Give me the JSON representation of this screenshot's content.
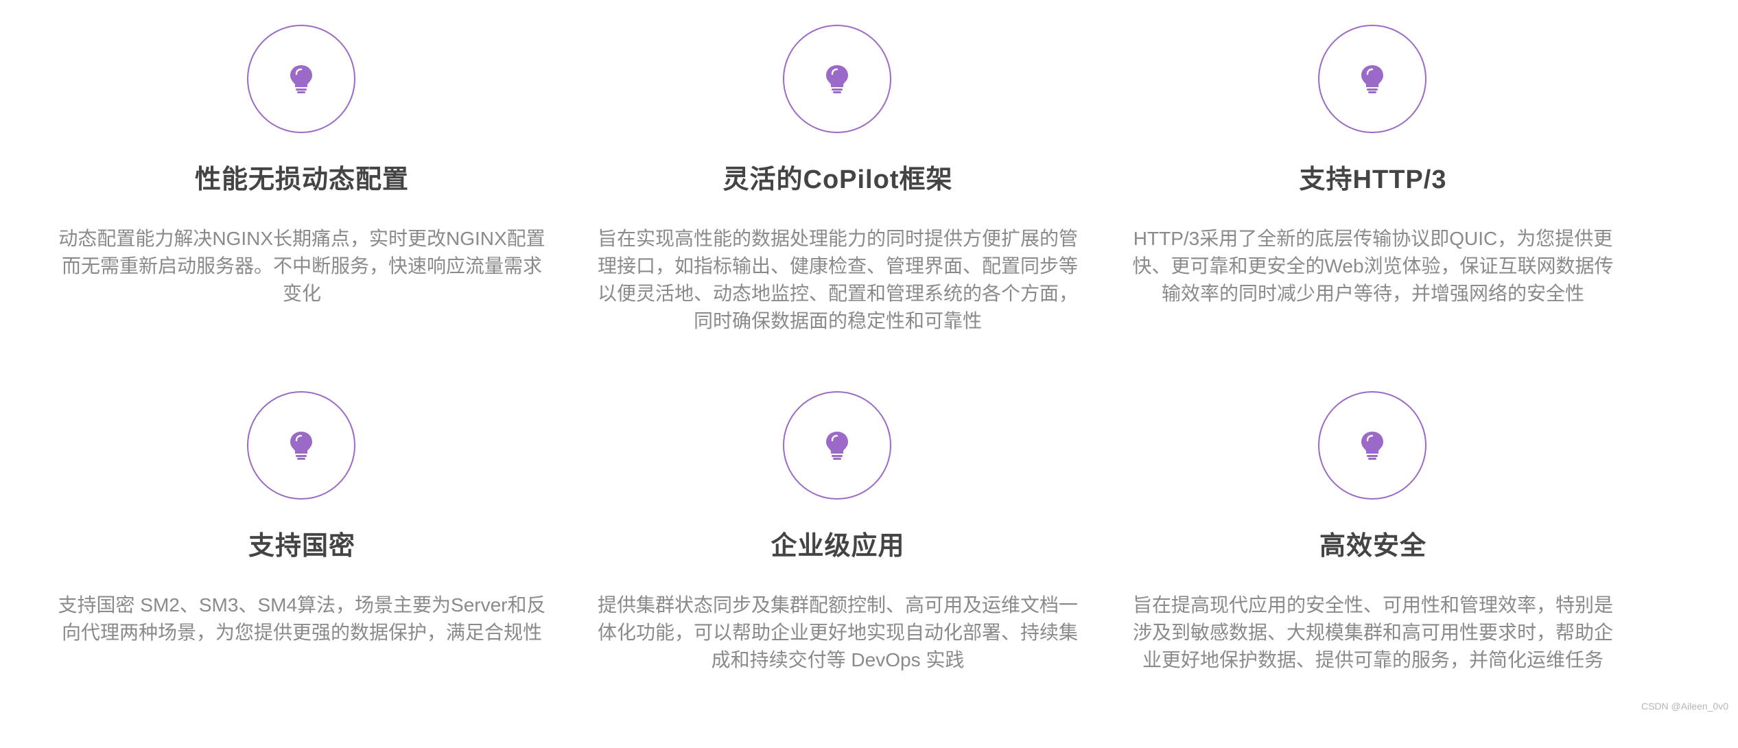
{
  "brand": {
    "accent": "#9b6ac8",
    "title_color": "#444444",
    "text_color": "#8a8a8a"
  },
  "features": [
    {
      "icon": "lightbulb-icon",
      "title": "性能无损动态配置",
      "lines": [
        "动态配置能力解决NGINX长期痛点，实时更改NGINX配置",
        "而无需重新启动服务器。不中断服务，快速响应流量需求",
        "变化"
      ]
    },
    {
      "icon": "lightbulb-icon",
      "title": "灵活的CoPilot框架",
      "lines": [
        "旨在实现高性能的数据处理能力的同时提供方便扩展的管",
        "理接口，如指标输出、健康检查、管理界面、配置同步等",
        "以便灵活地、动态地监控、配置和管理系统的各个方面，",
        "同时确保数据面的稳定性和可靠性"
      ]
    },
    {
      "icon": "lightbulb-icon",
      "title": "支持HTTP/3",
      "lines": [
        "HTTP/3采用了全新的底层传输协议即QUIC，为您提供更",
        "快、更可靠和更安全的Web浏览体验，保证互联网数据传",
        "输效率的同时减少用户等待，并增强网络的安全性"
      ]
    },
    {
      "icon": "lightbulb-icon",
      "title": "支持国密",
      "lines": [
        "支持国密 SM2、SM3、SM4算法，场景主要为Server和反",
        "向代理两种场景，为您提供更强的数据保护，满足合规性"
      ]
    },
    {
      "icon": "lightbulb-icon",
      "title": "企业级应用",
      "lines": [
        "提供集群状态同步及集群配额控制、高可用及运维文档一",
        "体化功能，可以帮助企业更好地实现自动化部署、持续集",
        "成和持续交付等 DevOps 实践"
      ]
    },
    {
      "icon": "lightbulb-icon",
      "title": "高效安全",
      "lines": [
        "旨在提高现代应用的安全性、可用性和管理效率，特别是",
        "涉及到敏感数据、大规模集群和高可用性要求时，帮助企",
        "业更好地保护数据、提供可靠的服务，并简化运维任务"
      ]
    }
  ],
  "watermark": "CSDN @Aileen_0v0"
}
